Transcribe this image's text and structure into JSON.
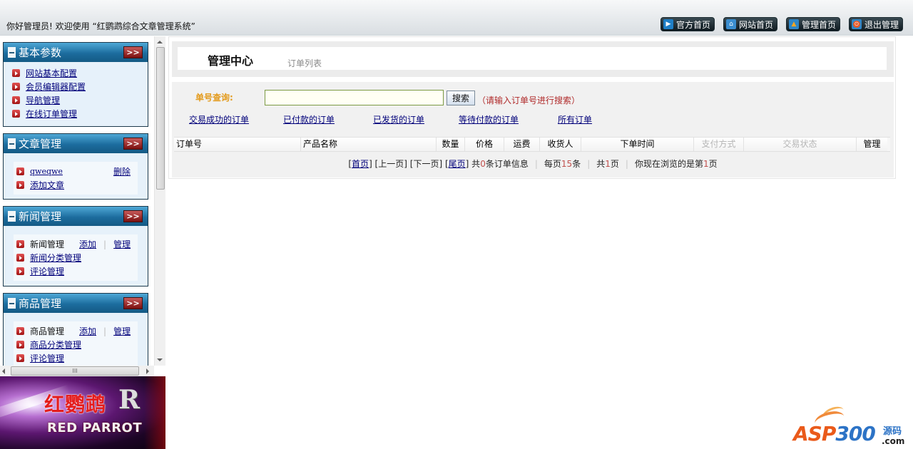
{
  "header": {
    "welcome": "你好管理员! 欢迎使用 “红鹦鹉综合文章管理系统”",
    "nav": [
      {
        "label": "官方首页",
        "icon": "play-icon"
      },
      {
        "label": "网站首页",
        "icon": "house-icon"
      },
      {
        "label": "管理首页",
        "icon": "warning-icon"
      },
      {
        "label": "退出管理",
        "icon": "power-icon"
      }
    ]
  },
  "sidebar": {
    "expand_label": ">>",
    "sections": [
      {
        "title": "基本参数",
        "items": [
          {
            "label": "网站基本配置"
          },
          {
            "label": "会员编辑器配置"
          },
          {
            "label": "导航管理"
          },
          {
            "label": "在线订单管理"
          }
        ]
      },
      {
        "title": "文章管理",
        "items": [
          {
            "label": "qweqwe",
            "action": "删除"
          },
          {
            "label": "添加文章"
          }
        ]
      },
      {
        "title": "新闻管理",
        "items": [
          {
            "label": "新闻管理",
            "add": "添加",
            "manage": "管理"
          },
          {
            "label": "新闻分类管理"
          },
          {
            "label": "评论管理"
          }
        ]
      },
      {
        "title": "商品管理",
        "items": [
          {
            "label": "商品管理",
            "add": "添加",
            "manage": "管理"
          },
          {
            "label": "商品分类管理"
          },
          {
            "label": "评论管理"
          }
        ]
      }
    ],
    "separator": "|",
    "hscroll_grip": "III"
  },
  "banner": {
    "cn_text": "红鹦鹉",
    "mark": "R",
    "en_text": "RED PARROT"
  },
  "main": {
    "title": "管理中心",
    "subtitle": "订单列表",
    "search": {
      "label": "单号查询:",
      "value": "",
      "placeholder": "",
      "button": "搜索",
      "hint": "（请输入订单号进行搜索）"
    },
    "filters": [
      "交易成功的订单",
      "已付款的订单",
      "已发货的订单",
      "等待付款的订单",
      "所有订单"
    ],
    "columns": [
      "订单号",
      "产品名称",
      "数量",
      "价格",
      "运费",
      "收货人",
      "下单时间",
      "支付方式",
      "交易状态",
      "管理"
    ],
    "rows": [],
    "pager": {
      "first": "首页",
      "prev": "上一页",
      "next": "下一页",
      "last": "尾页",
      "total_prefix": "共",
      "total_count": "0",
      "total_suffix": "条订单信息",
      "per_page_prefix": "每页",
      "per_page": "15",
      "per_page_suffix": "条",
      "pages_prefix": "共",
      "pages": "1",
      "pages_suffix": "页",
      "current_prefix": "你现在浏览的是第",
      "current": "1",
      "current_suffix": "页"
    }
  },
  "footer": {
    "logo_asp": "ASP",
    "logo_300": "300",
    "logo_yuanma": "源码",
    "logo_com": ".com"
  }
}
